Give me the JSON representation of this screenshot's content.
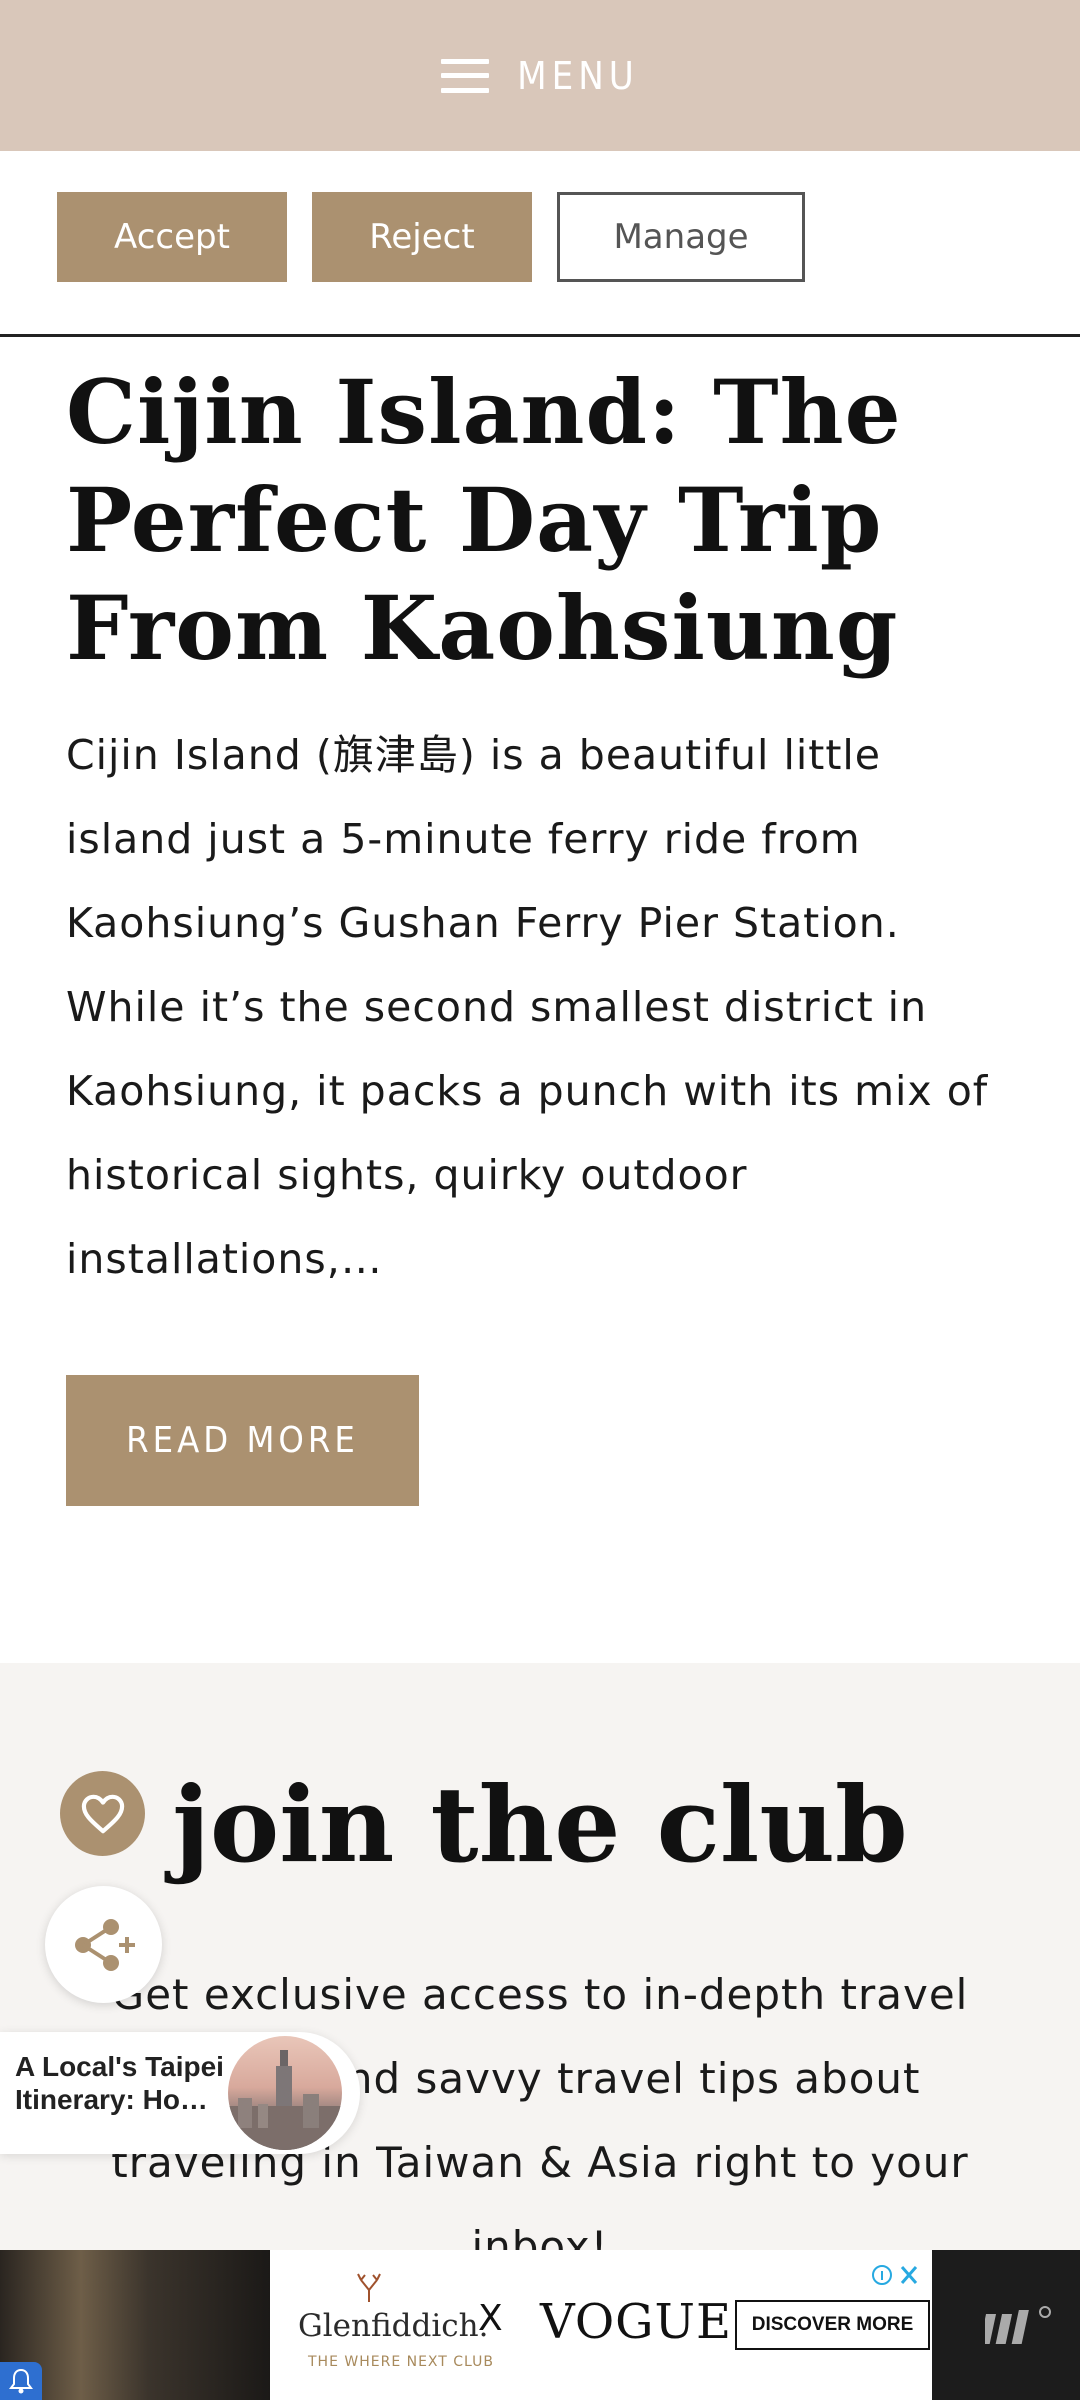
{
  "header": {
    "menu_label": "MENU",
    "background": "#d9c7ba"
  },
  "consent": {
    "accept_label": "Accept",
    "reject_label": "Reject",
    "manage_label": "Manage",
    "accent": "#ab9170"
  },
  "post": {
    "title": "Cijin Island: The Perfect Day Trip From Kaohsiung",
    "excerpt": "Cijin Island (旗津島) is a beautiful little island just a 5-minute ferry ride from Kaohsiung’s Gushan Ferry Pier Station. While it’s the second smallest district in Kaohsiung, it packs a punch with its mix of historical sights, quirky outdoor installations,…",
    "read_more_label": "READ MORE"
  },
  "club": {
    "title": "join the club",
    "text": "Get exclusive access to in-depth travel guides and savvy travel tips about traveling in Taiwan & Asia right to your inbox!"
  },
  "floating": {
    "heart_icon": "heart-icon",
    "share_icon": "share-icon"
  },
  "recommendation": {
    "title": "A Local's Taipei Itinerary: Ho…"
  },
  "ad": {
    "brand": "Glenfiddich.",
    "brand_sub": "THE WHERE NEXT CLUB",
    "separator": "X",
    "partner": "VOGUE",
    "cta_label": "DISCOVER MORE"
  }
}
